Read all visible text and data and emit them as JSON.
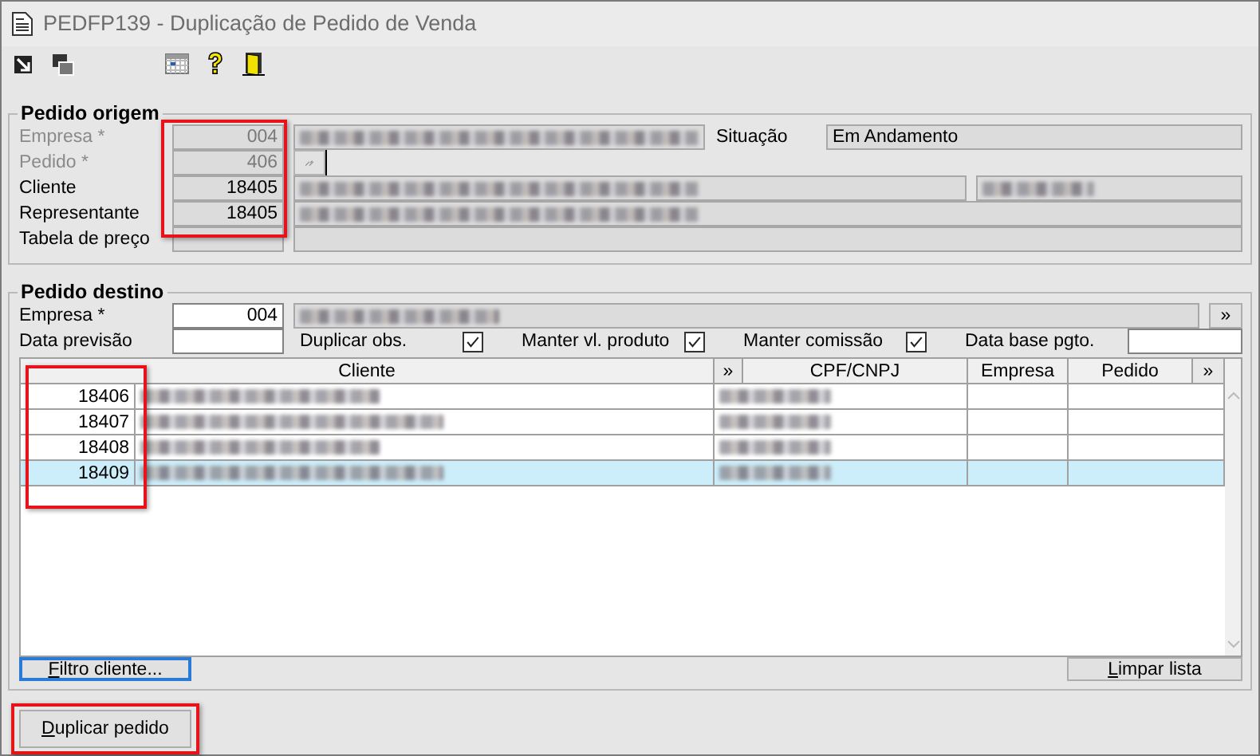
{
  "window": {
    "title": "PEDFP139 - Duplicação de Pedido de Venda"
  },
  "toolbar": [
    {
      "kind": "arrow"
    },
    {
      "kind": "stack"
    },
    {
      "kind": "calendar"
    },
    {
      "kind": "help"
    },
    {
      "kind": "exit"
    }
  ],
  "origin": {
    "legend": "Pedido origem",
    "highlighted": true,
    "status_label": "Situação",
    "status": "Em Andamento",
    "rows": [
      {
        "label": "Empresa *",
        "code": "004",
        "disabled": true,
        "redacted": true
      },
      {
        "label": "Pedido *",
        "code": "406",
        "disabled": true,
        "redacted": false
      },
      {
        "label": "Cliente",
        "code": "18405",
        "disabled": false,
        "redacted": true
      },
      {
        "label": "Representante",
        "code": "18405",
        "disabled": false,
        "redacted": true
      },
      {
        "label": "Tabela de preço",
        "disabled": false,
        "redacted": false
      }
    ]
  },
  "destination": {
    "legend": "Pedido destino",
    "empresa_label": "Empresa *",
    "empresa_code": "004",
    "empresa_redacted": true,
    "more_button": "»",
    "date_label": "Data previsão",
    "options": [
      {
        "label": "Duplicar obs.",
        "checked": true
      },
      {
        "label": "Manter vl. produto",
        "checked": true
      },
      {
        "label": "Manter comissão",
        "checked": true
      }
    ],
    "base_date_label": "Data base pgto.",
    "grid": {
      "highlighted": true,
      "columns": [
        {
          "label": "Cliente"
        },
        {
          "label": "»"
        },
        {
          "label": "CPF/CNPJ"
        },
        {
          "label": "Empresa"
        },
        {
          "label": "Pedido"
        },
        {
          "label": "»"
        }
      ],
      "rows": [
        {
          "code": "18406",
          "redacted": true,
          "selected": false
        },
        {
          "code": "18407",
          "redacted": true,
          "selected": false
        },
        {
          "code": "18408",
          "redacted": true,
          "selected": false
        },
        {
          "code": "18409",
          "redacted": true,
          "selected": true
        }
      ]
    },
    "filter_button": {
      "label": "Filtro cliente...",
      "focused": true
    },
    "clear_button": {
      "label": "Limpar lista",
      "focused": false
    }
  },
  "duplicate_button": {
    "label": "Duplicar pedido",
    "highlighted": true
  }
}
